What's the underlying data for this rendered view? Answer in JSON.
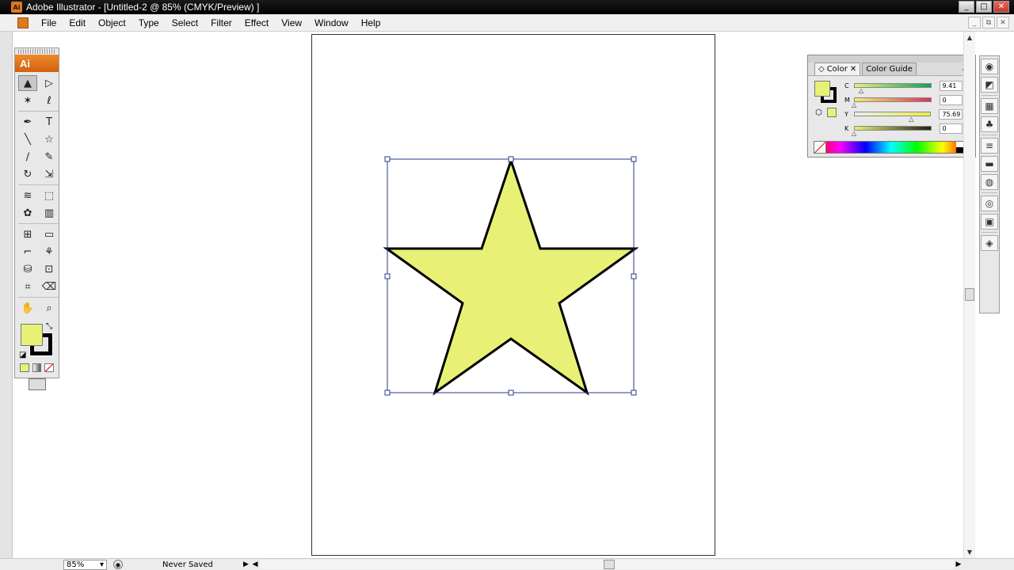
{
  "window": {
    "app_icon": "Ai",
    "title": "Adobe Illustrator - [Untitled-2 @ 85% (CMYK/Preview) ]",
    "controls": {
      "minimize": "_",
      "restore": "□",
      "close": "✕"
    }
  },
  "menu": {
    "items": [
      "File",
      "Edit",
      "Object",
      "Type",
      "Select",
      "Filter",
      "Effect",
      "View",
      "Window",
      "Help"
    ],
    "doc_controls": {
      "minimize": "_",
      "restore": "⧉",
      "close": "✕"
    }
  },
  "toolbox": {
    "logo": "Ai",
    "tools": [
      {
        "name": "selection-tool",
        "icon": "▲",
        "active": true
      },
      {
        "name": "direct-selection-tool",
        "icon": "▷"
      },
      {
        "name": "magic-wand-tool",
        "icon": "✶"
      },
      {
        "name": "lasso-tool",
        "icon": "ℓ"
      },
      {
        "name": "pen-tool",
        "icon": "✒"
      },
      {
        "name": "type-tool",
        "icon": "T"
      },
      {
        "name": "line-segment-tool",
        "icon": "╲"
      },
      {
        "name": "star-tool",
        "icon": "☆"
      },
      {
        "name": "paintbrush-tool",
        "icon": "∕"
      },
      {
        "name": "pencil-tool",
        "icon": "✎"
      },
      {
        "name": "rotate-tool",
        "icon": "↻"
      },
      {
        "name": "scale-tool",
        "icon": "⇲"
      },
      {
        "name": "warp-tool",
        "icon": "≋"
      },
      {
        "name": "free-transform-tool",
        "icon": "⬚"
      },
      {
        "name": "symbol-sprayer-tool",
        "icon": "✿"
      },
      {
        "name": "column-graph-tool",
        "icon": "▥"
      },
      {
        "name": "mesh-tool",
        "icon": "⊞"
      },
      {
        "name": "gradient-tool",
        "icon": "▭"
      },
      {
        "name": "eyedropper-tool",
        "icon": "⌐"
      },
      {
        "name": "blend-tool",
        "icon": "⚘"
      },
      {
        "name": "live-paint-bucket-tool",
        "icon": "⛁"
      },
      {
        "name": "live-paint-selection-tool",
        "icon": "⊡"
      },
      {
        "name": "crop-area-tool",
        "icon": "⌗"
      },
      {
        "name": "eraser-tool",
        "icon": "⌫"
      },
      {
        "name": "hand-tool",
        "icon": "✋"
      },
      {
        "name": "zoom-tool",
        "icon": "⌕"
      }
    ],
    "fill_color": "#e8f076",
    "stroke_color": "#000000"
  },
  "color_panel": {
    "tabs": [
      "Color",
      "Color Guide"
    ],
    "active_tab": "Color",
    "fill_color": "#e8f076",
    "sliders": [
      {
        "label": "C",
        "value": "9.41",
        "fraction": 0.0941,
        "gradient": [
          "#e8f076",
          "#10a060"
        ]
      },
      {
        "label": "M",
        "value": "0",
        "fraction": 0,
        "gradient": [
          "#e8f076",
          "#e03060"
        ]
      },
      {
        "label": "Y",
        "value": "75.69",
        "fraction": 0.7569,
        "gradient": [
          "#e8f0f0",
          "#e8f040"
        ]
      },
      {
        "label": "K",
        "value": "0",
        "fraction": 0,
        "gradient": [
          "#e8f076",
          "#202010"
        ]
      }
    ],
    "percent_sign": "%"
  },
  "canvas": {
    "star_fill": "#e8f076",
    "star_stroke": "#000000",
    "selection_color": "#2a3a8a"
  },
  "status": {
    "zoom": "85%",
    "save_state": "Never Saved"
  }
}
